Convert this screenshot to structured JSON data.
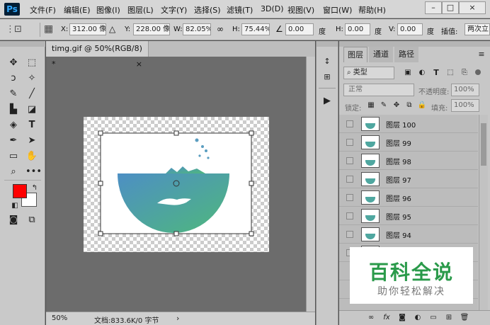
{
  "app": {
    "logo": "Ps"
  },
  "menubar": {
    "items": [
      "文件(F)",
      "编辑(E)",
      "图像(I)",
      "图层(L)",
      "文字(Y)",
      "选择(S)",
      "滤镜(T)",
      "3D(D)",
      "视图(V)",
      "窗口(W)",
      "帮助(H)"
    ],
    "window_controls": [
      "–",
      "□",
      "×"
    ]
  },
  "options": {
    "x_label": "X:",
    "x_value": "312.00 像素",
    "y_label": "Y:",
    "y_value": "228.00 像素",
    "w_label": "W:",
    "w_value": "82.05%",
    "h_label": "H:",
    "h_value": "75.44%",
    "angle_value": "0.00",
    "angle_unit": "度",
    "hskew_label": "H:",
    "hskew_value": "0.00",
    "hskew_unit": "度",
    "vskew_label": "V:",
    "vskew_value": "0.00",
    "vskew_unit": "度",
    "interp_label": "插值:",
    "interp_value": "两次立"
  },
  "document": {
    "tab_title": "timg.gif @ 50%(RGB/8) *",
    "tab_close": "×",
    "zoom": "50%",
    "doc_info": "文档:833.6K/0 字节",
    "status_arrow": "›"
  },
  "colors": {
    "foreground": "#ff0000",
    "background": "#ffffff",
    "art_top": "#4d8fc4",
    "art_bottom": "#4fb87c"
  },
  "layers_panel": {
    "tabs": [
      "图层",
      "通道",
      "路径"
    ],
    "filter_kind": "类型",
    "blend_mode": "正常",
    "opacity_label": "不透明度:",
    "opacity_value": "100%",
    "lock_label": "锁定:",
    "fill_label": "填充:",
    "fill_value": "100%",
    "layers": [
      {
        "name": "图层 100"
      },
      {
        "name": "图层 99"
      },
      {
        "name": "图层 98"
      },
      {
        "name": "图层 97"
      },
      {
        "name": "图层 96"
      },
      {
        "name": "图层 95"
      },
      {
        "name": "图层 94"
      }
    ]
  },
  "watermark": {
    "title": "百科全说",
    "subtitle": "助你轻松解决"
  }
}
